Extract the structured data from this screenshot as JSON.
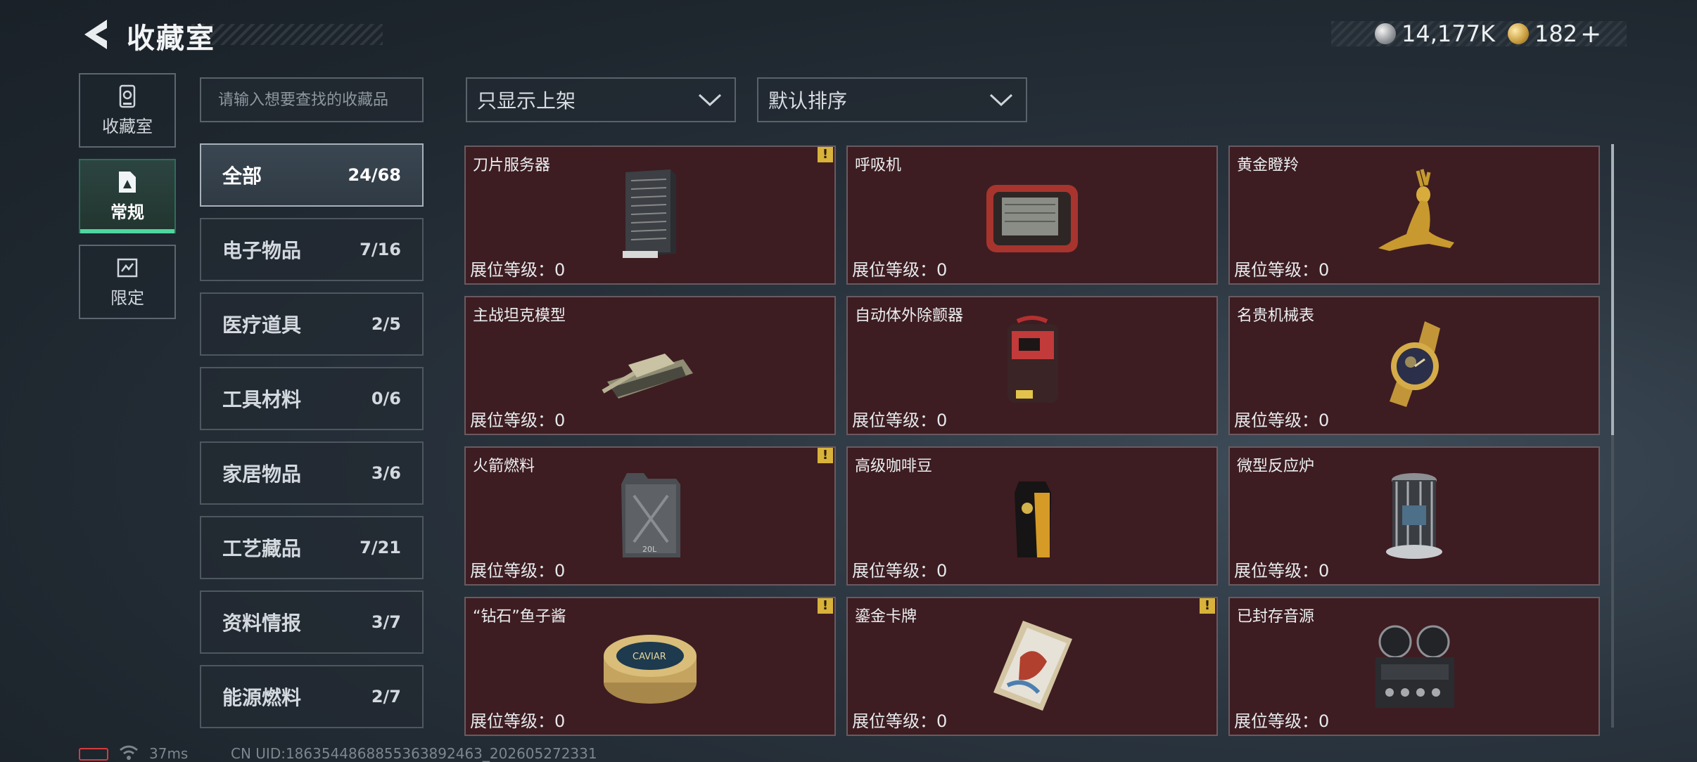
{
  "header": {
    "title": "收藏室"
  },
  "currency": [
    {
      "icon": "silver-coin-icon",
      "value": "14,177K"
    },
    {
      "icon": "gold-coin-icon",
      "value": "182"
    }
  ],
  "currency_plus": "+",
  "rail": [
    {
      "label": "收藏室",
      "icon": "collection-room-icon",
      "active": false
    },
    {
      "label": "常规",
      "icon": "regular-icon",
      "active": true
    },
    {
      "label": "限定",
      "icon": "limited-icon",
      "active": false
    }
  ],
  "search": {
    "placeholder": "请输入想要查找的收藏品"
  },
  "filters": {
    "display": "只显示上架",
    "sort": "默认排序"
  },
  "categories": [
    {
      "label": "全部",
      "count": "24/68",
      "active": true
    },
    {
      "label": "电子物品",
      "count": "7/16"
    },
    {
      "label": "医疗道具",
      "count": "2/5"
    },
    {
      "label": "工具材料",
      "count": "0/6"
    },
    {
      "label": "家居物品",
      "count": "3/6"
    },
    {
      "label": "工艺藏品",
      "count": "7/21"
    },
    {
      "label": "资料情报",
      "count": "3/7"
    },
    {
      "label": "能源燃料",
      "count": "2/7"
    }
  ],
  "level_label": "展位等级：0",
  "items": [
    {
      "name": "刀片服务器",
      "icon": "blade-server-icon",
      "warning": true
    },
    {
      "name": "呼吸机",
      "icon": "ventilator-icon",
      "warning": false
    },
    {
      "name": "黄金瞪羚",
      "icon": "golden-gazelle-icon",
      "warning": false
    },
    {
      "name": "主战坦克模型",
      "icon": "tank-model-icon",
      "warning": false
    },
    {
      "name": "自动体外除颤器",
      "icon": "defibrillator-icon",
      "warning": false
    },
    {
      "name": "名贵机械表",
      "icon": "luxury-watch-icon",
      "warning": false
    },
    {
      "name": "火箭燃料",
      "icon": "rocket-fuel-icon",
      "warning": true
    },
    {
      "name": "高级咖啡豆",
      "icon": "coffee-beans-icon",
      "warning": false
    },
    {
      "name": "微型反应炉",
      "icon": "micro-reactor-icon",
      "warning": false
    },
    {
      "name": "“钻石”鱼子酱",
      "icon": "caviar-icon",
      "warning": true
    },
    {
      "name": "鎏金卡牌",
      "icon": "gilded-card-icon",
      "warning": true
    },
    {
      "name": "已封存音源",
      "icon": "sealed-audio-icon",
      "warning": false
    }
  ],
  "item_art_text": {
    "caviar": "CAVIAR",
    "fuel": "20L"
  },
  "footer": {
    "ping": "37ms",
    "uid": "CN UID:1863544868855363892463_202605272331"
  },
  "colors": {
    "card_bg": "#3d1d22",
    "active_accent": "#4fd6a0",
    "warning": "#d8b23a"
  }
}
